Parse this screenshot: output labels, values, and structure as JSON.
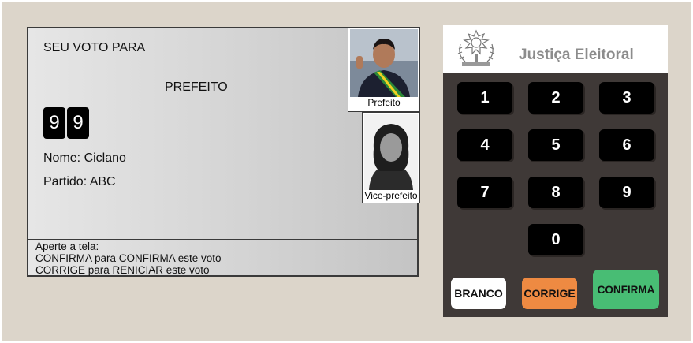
{
  "screen": {
    "title": "SEU VOTO PARA",
    "office": "PREFEITO",
    "digits": [
      "9",
      "9"
    ],
    "name_line": "Nome: Ciclano",
    "party_line": "Partido: ABC",
    "photos": {
      "mayor_caption": "Prefeito",
      "vice_caption": "Vice-prefeito"
    },
    "instructions": {
      "line1": "Aperte a tela:",
      "line2": "CONFIRMA para CONFIRMA este voto",
      "line3": "CORRIGE para RENICIAR este voto"
    }
  },
  "keypad": {
    "title": "Justiça Eleitoral",
    "keys": [
      "1",
      "2",
      "3",
      "4",
      "5",
      "6",
      "7",
      "8",
      "9",
      "0"
    ],
    "branco_label": "BRANCO",
    "corrige_label": "CORRIGE",
    "confirma_label": "CONFIRMA"
  },
  "colors": {
    "frame_bg": "#dcd5ca",
    "keypad_bg": "#3f3937",
    "corrige": "#ee8a42",
    "confirma": "#48bd74",
    "branco": "#ffffff"
  },
  "icons": {
    "seal": "coat-of-arms-icon"
  }
}
